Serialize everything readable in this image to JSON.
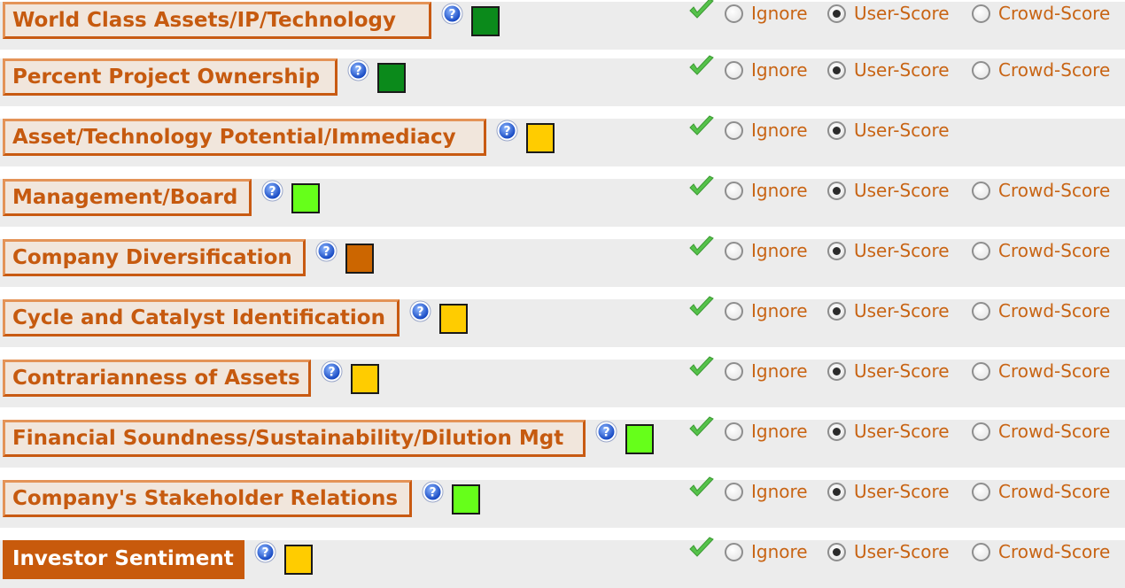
{
  "options": {
    "ignore": "Ignore",
    "user_score": "User-Score",
    "crowd_score": "Crowd-Score"
  },
  "colors": {
    "dark_green": "#0b8a1b",
    "lime": "#66ff1a",
    "yellow": "#ffcc00",
    "brown": "#cc6600",
    "accent": "#c65a0f"
  },
  "criteria": [
    {
      "label": "World Class Assets/IP/Technology",
      "rating_color": "#0b8a1b",
      "selected": "user_score",
      "show_crowd": true,
      "active": false
    },
    {
      "label": "Percent Project Ownership",
      "rating_color": "#0b8a1b",
      "selected": "user_score",
      "show_crowd": true,
      "active": false
    },
    {
      "label": "Asset/Technology Potential/Immediacy",
      "rating_color": "#ffcc00",
      "selected": "user_score",
      "show_crowd": false,
      "active": false
    },
    {
      "label": "Management/Board",
      "rating_color": "#66ff1a",
      "selected": "user_score",
      "show_crowd": true,
      "active": false
    },
    {
      "label": "Company Diversification",
      "rating_color": "#cc6600",
      "selected": "user_score",
      "show_crowd": true,
      "active": false
    },
    {
      "label": "Cycle and Catalyst Identification",
      "rating_color": "#ffcc00",
      "selected": "user_score",
      "show_crowd": true,
      "active": false
    },
    {
      "label": "Contrarianness of Assets",
      "rating_color": "#ffcc00",
      "selected": "user_score",
      "show_crowd": true,
      "active": false
    },
    {
      "label": "Financial Soundness/Sustainability/Dilution Mgt",
      "rating_color": "#66ff1a",
      "selected": "user_score",
      "show_crowd": true,
      "active": false
    },
    {
      "label": "Company's Stakeholder Relations",
      "rating_color": "#66ff1a",
      "selected": "user_score",
      "show_crowd": true,
      "active": false
    },
    {
      "label": "Investor Sentiment",
      "rating_color": "#ffcc00",
      "selected": "user_score",
      "show_crowd": true,
      "active": true
    }
  ]
}
